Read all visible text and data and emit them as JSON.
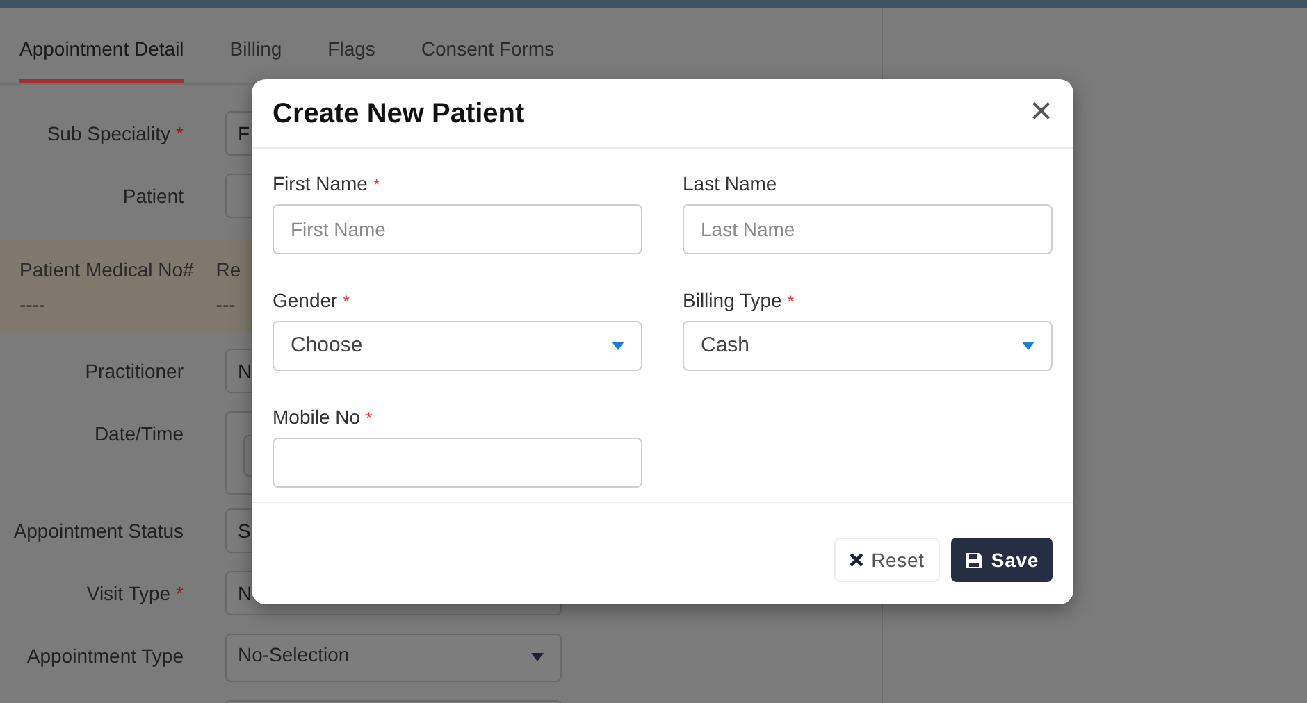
{
  "tabs": [
    {
      "label": "Appointment Detail",
      "selected": true
    },
    {
      "label": "Billing",
      "selected": false
    },
    {
      "label": "Flags",
      "selected": false
    },
    {
      "label": "Consent Forms",
      "selected": false
    }
  ],
  "required_mark": "*",
  "form_top": [
    {
      "label": "Sub Speciality",
      "required": true,
      "value": "F"
    },
    {
      "label": "Patient",
      "required": false
    }
  ],
  "info_band": [
    {
      "label": "Patient Medical No#",
      "value": "----"
    },
    {
      "label": "Re",
      "value": "---"
    }
  ],
  "form_bottom": [
    {
      "label": "Practitioner",
      "required": false,
      "value": "N"
    },
    {
      "label": "Date/Time",
      "required": false,
      "kind": "datetime"
    },
    {
      "label": "Appointment Status",
      "required": false,
      "value": "S"
    },
    {
      "label": "Visit Type",
      "required": true,
      "value": "N"
    },
    {
      "label": "Appointment Type",
      "required": false,
      "value": "No-Selection",
      "kind": "dropdown"
    },
    {
      "kind": "select"
    }
  ],
  "modal": {
    "title": "Create New Patient",
    "close": "×",
    "fields": [
      {
        "label": "First Name",
        "required": true,
        "kind": "input",
        "placeholder": "First Name"
      },
      {
        "label": "Last Name",
        "required": false,
        "kind": "input",
        "placeholder": "Last Name"
      },
      {
        "label": "Gender",
        "required": true,
        "kind": "select",
        "value": "Choose"
      },
      {
        "label": "Billing Type",
        "required": true,
        "kind": "select",
        "value": "Cash"
      },
      {
        "label": "Mobile No",
        "required": true,
        "kind": "input"
      }
    ],
    "buttons": [
      {
        "label": "Reset",
        "kind": "reset"
      },
      {
        "label": "Save",
        "kind": "save"
      }
    ]
  }
}
